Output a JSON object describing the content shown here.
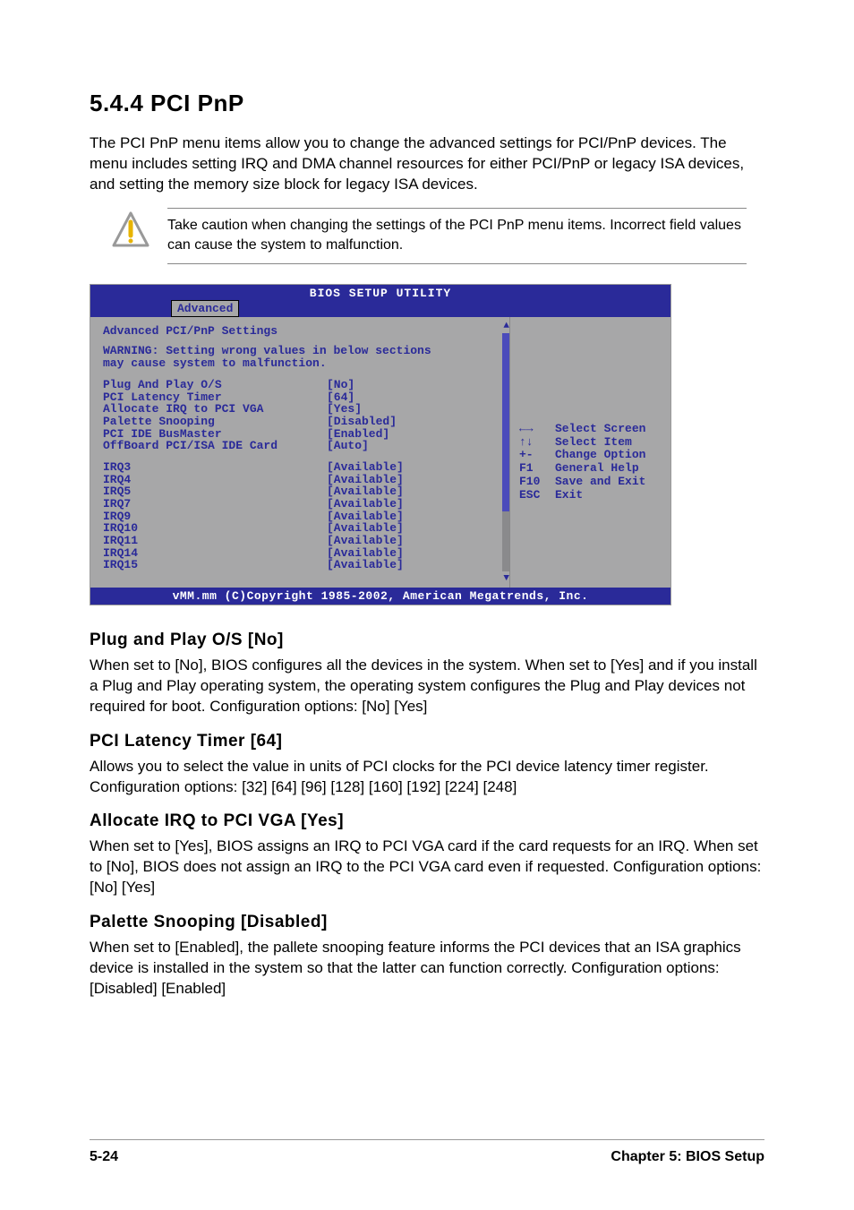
{
  "heading": "5.4.4   PCI PnP",
  "intro": "The PCI PnP menu items allow you to change the advanced settings for PCI/PnP devices. The menu includes setting IRQ and DMA channel resources for either PCI/PnP or legacy ISA devices, and setting the memory size block for legacy ISA devices.",
  "caution": "Take caution when changing the settings of the PCI PnP menu items. Incorrect field values can cause the system to malfunction.",
  "bios": {
    "title": "BIOS SETUP UTILITY",
    "tab": "Advanced",
    "section_heading": "Advanced PCI/PnP Settings",
    "warning_l1": "WARNING: Setting wrong values in below sections",
    "warning_l2": "         may cause system to malfunction.",
    "rows1": [
      {
        "label": "Plug And Play O/S",
        "value": "[No]"
      },
      {
        "label": "PCI Latency Timer",
        "value": "[64]"
      },
      {
        "label": "Allocate IRQ to PCI VGA",
        "value": "[Yes]"
      },
      {
        "label": "Palette Snooping",
        "value": "[Disabled]"
      },
      {
        "label": "PCI IDE BusMaster",
        "value": "[Enabled]"
      },
      {
        "label": "OffBoard PCI/ISA IDE Card",
        "value": "[Auto]"
      }
    ],
    "rows2": [
      {
        "label": "IRQ3",
        "value": "[Available]"
      },
      {
        "label": "IRQ4",
        "value": "[Available]"
      },
      {
        "label": "IRQ5",
        "value": "[Available]"
      },
      {
        "label": "IRQ7",
        "value": "[Available]"
      },
      {
        "label": "IRQ9",
        "value": "[Available]"
      },
      {
        "label": "IRQ10",
        "value": "[Available]"
      },
      {
        "label": "IRQ11",
        "value": "[Available]"
      },
      {
        "label": "IRQ14",
        "value": "[Available]"
      },
      {
        "label": "IRQ15",
        "value": "[Available]"
      }
    ],
    "legend": [
      {
        "key": "←→",
        "action": "Select Screen"
      },
      {
        "key": "↑↓",
        "action": "Select Item"
      },
      {
        "key": "+-",
        "action": "Change Option"
      },
      {
        "key": "F1",
        "action": "General Help"
      },
      {
        "key": "F10",
        "action": "Save and Exit"
      },
      {
        "key": "ESC",
        "action": "Exit"
      }
    ],
    "footer": "vMM.mm (C)Copyright 1985-2002, American Megatrends, Inc."
  },
  "subs": [
    {
      "title": "Plug and Play O/S [No]",
      "body": "When set to [No], BIOS configures all the devices in the system. When set to [Yes] and if you install a Plug and Play operating system, the operating system configures the Plug and Play devices not required for boot. Configuration options: [No] [Yes]"
    },
    {
      "title": "PCI Latency Timer [64]",
      "body": "Allows you to select the value in units of PCI clocks for the PCI device latency timer register. Configuration options: [32] [64] [96] [128] [160] [192] [224] [248]"
    },
    {
      "title": "Allocate IRQ to PCI VGA [Yes]",
      "body": "When set to [Yes], BIOS assigns an IRQ to PCI VGA card if the card requests for an IRQ. When set to [No], BIOS does not assign an IRQ to the PCI VGA card even if requested. Configuration options: [No] [Yes]"
    },
    {
      "title": "Palette Snooping [Disabled]",
      "body": "When set to [Enabled], the pallete snooping feature informs the PCI devices that an ISA graphics device is installed in the system so that the latter can function correctly. Configuration options: [Disabled] [Enabled]"
    }
  ],
  "footer": {
    "left": "5-24",
    "right": "Chapter 5: BIOS Setup"
  }
}
